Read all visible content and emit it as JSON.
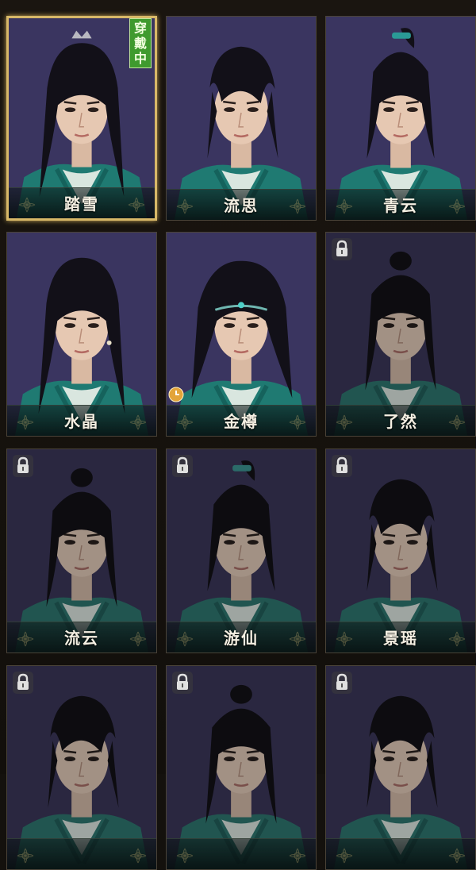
{
  "grid": {
    "cards": [
      {
        "name": "踏雪",
        "status": "equipped",
        "badge": "穿戴中",
        "locked": false,
        "timed": false,
        "hair": "loose-long",
        "accessory": "crown"
      },
      {
        "name": "流思",
        "status": "available",
        "locked": false,
        "timed": false,
        "hair": "short-messy",
        "accessory": "none"
      },
      {
        "name": "青云",
        "status": "available",
        "locked": false,
        "timed": false,
        "hair": "high-ponytail",
        "accessory": "teal-band"
      },
      {
        "name": "水晶",
        "status": "available",
        "locked": false,
        "timed": false,
        "hair": "loose-long",
        "accessory": "earring"
      },
      {
        "name": "金樽",
        "status": "timed",
        "locked": false,
        "timed": true,
        "hair": "wild-long",
        "accessory": "headband"
      },
      {
        "name": "了然",
        "status": "locked",
        "locked": true,
        "timed": false,
        "hair": "topknot",
        "accessory": "none"
      },
      {
        "name": "流云",
        "status": "locked",
        "locked": true,
        "timed": false,
        "hair": "topknot",
        "accessory": "none"
      },
      {
        "name": "游仙",
        "status": "locked",
        "locked": true,
        "timed": false,
        "hair": "high-ponytail",
        "accessory": "teal-band"
      },
      {
        "name": "景瑶",
        "status": "locked",
        "locked": true,
        "timed": false,
        "hair": "short-messy",
        "accessory": "none"
      },
      {
        "name": "",
        "status": "locked",
        "locked": true,
        "timed": false,
        "hair": "short-messy",
        "accessory": "none"
      },
      {
        "name": "",
        "status": "locked",
        "locked": true,
        "timed": false,
        "hair": "topknot",
        "accessory": "none"
      },
      {
        "name": "",
        "status": "locked",
        "locked": true,
        "timed": false,
        "hair": "short-messy",
        "accessory": "none"
      }
    ]
  },
  "icons": {
    "lock": "padlock-icon",
    "timer": "clock-icon",
    "ornament": "flower-ornament-icon"
  },
  "colors": {
    "card_bg": "#2b2740",
    "selected_border": "#d8b868",
    "equipped_badge": "#3f9a2e",
    "robe": "#1f7a72",
    "hair": "#121018"
  }
}
